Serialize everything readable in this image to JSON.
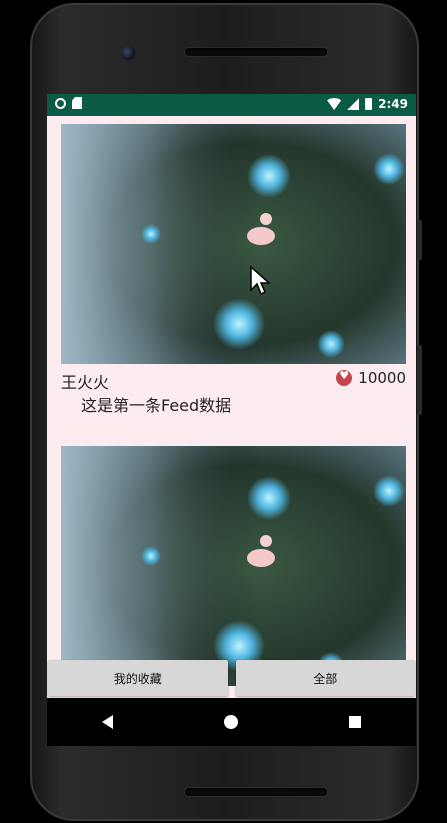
{
  "status_bar": {
    "time": "2:49",
    "icons": [
      "circle-icon",
      "sd-card-icon",
      "wifi-icon",
      "signal-icon",
      "battery-icon"
    ]
  },
  "feed": [
    {
      "author": "王火火",
      "likes": "10000",
      "text": "这是第一条Feed数据"
    },
    {
      "author": "",
      "likes": ""
    }
  ],
  "bottom_buttons": {
    "favorites": "我的收藏",
    "all": "全部"
  },
  "nav_bar": [
    "back-icon",
    "home-icon",
    "recents-icon"
  ],
  "colors": {
    "status_bar": "#0b5a45",
    "background": "#fdecef",
    "heart": "#c4454a",
    "button": "#d7d7d7"
  }
}
